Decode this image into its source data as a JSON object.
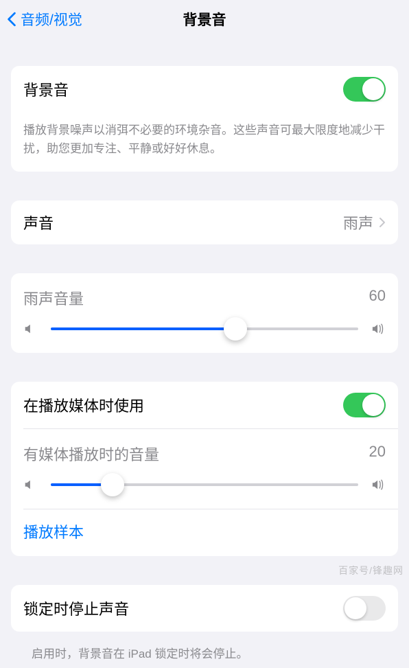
{
  "nav": {
    "back": "音频/视觉",
    "title": "背景音"
  },
  "bg_sound": {
    "label": "背景音",
    "enabled": true,
    "desc": "播放背景噪声以消弭不必要的环境杂音。这些声音可最大限度地减少干扰，助您更加专注、平静或好好休息。"
  },
  "sound_row": {
    "label": "声音",
    "value": "雨声"
  },
  "volume1": {
    "title": "雨声音量",
    "value": 60
  },
  "media": {
    "label": "在播放媒体时使用",
    "enabled": true,
    "vol_title": "有媒体播放时的音量",
    "vol_value": 20,
    "sample": "播放样本"
  },
  "lock": {
    "label": "锁定时停止声音",
    "enabled": false,
    "desc": "启用时，背景音在 iPad 锁定时将会停止。"
  },
  "watermark": "百家号/锋趣网"
}
